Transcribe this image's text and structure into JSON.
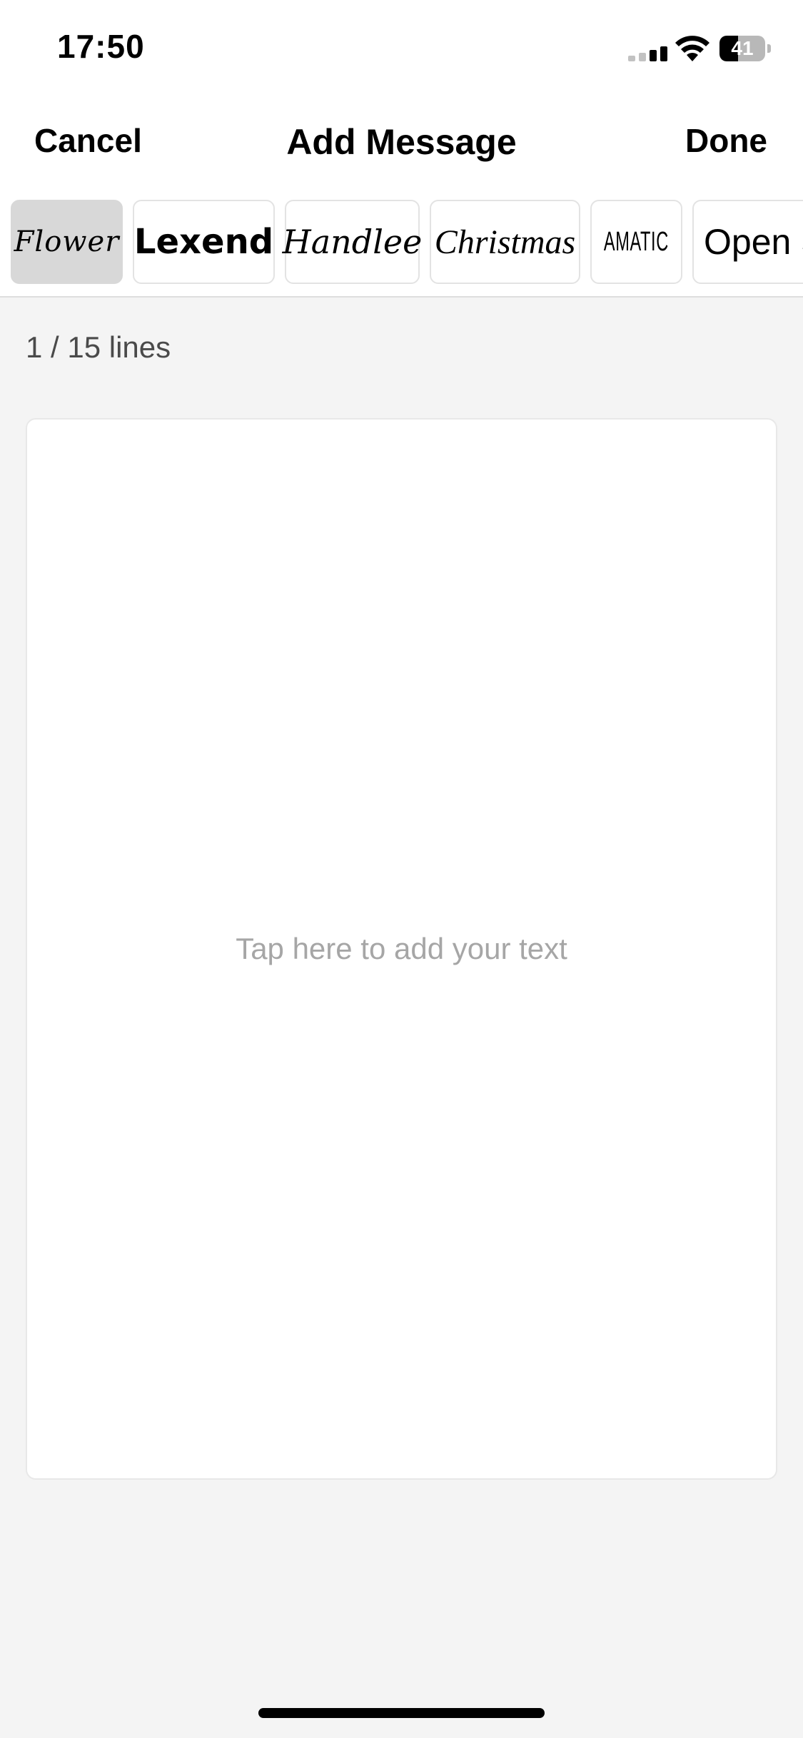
{
  "status_bar": {
    "time": "17:50",
    "battery_level": "41",
    "battery_fraction": 0.41,
    "icons": [
      "signal-icon",
      "wifi-icon",
      "battery-icon"
    ]
  },
  "nav": {
    "cancel_label": "Cancel",
    "title": "Add Message",
    "done_label": "Done"
  },
  "fonts": {
    "selected": "Flower",
    "items": [
      {
        "label": "Flower"
      },
      {
        "label": "Lexend"
      },
      {
        "label": "Handlee"
      },
      {
        "label": "Christmas"
      },
      {
        "label": "AMATIC"
      },
      {
        "label": "Open S"
      }
    ]
  },
  "editor": {
    "line_count": "1 / 15 lines",
    "placeholder": "Tap here to add your text"
  },
  "colors": {
    "background": "#f4f4f4",
    "selected_chip": "#d8d8d8",
    "placeholder_text": "#a6a6a6"
  }
}
